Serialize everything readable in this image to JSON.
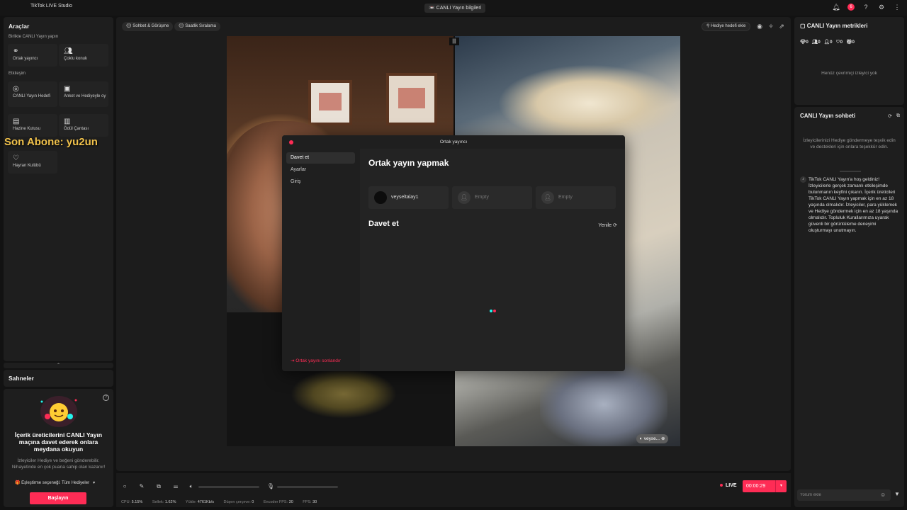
{
  "app": {
    "title": "TikTok LIVE Studio",
    "live_info_label": "📼 CANLI Yayın bilgileri",
    "notification_count": "6"
  },
  "tools": {
    "title": "Araçlar",
    "section_together": "Birlikte CANLI Yayın yapın",
    "cohost_label": "Ortak yayıncı",
    "multiguest_label": "Çoklu konuk",
    "section_interaction": "Etkileşim",
    "live_goal_label": "CANLI Yayın Hedefi",
    "poll_label": "Anket ve Hediyeyle oy",
    "treasure_label": "Hazine Kutusu",
    "reward_label": "Ödül Çantası",
    "fanclub_label": "Hayran Kulübü"
  },
  "overlay": {
    "last_sub": "Son Abone: yu2un"
  },
  "scenes": {
    "title": "Sahneler"
  },
  "promo": {
    "title": "İçerik üreticilerini CANLI Yayın maçına davet ederek onlara meydana okuyun",
    "desc": "İzleyiciler Hediye ve beğeni gönderebilir. Nihayetinde en çok puana sahip olan kazanır!",
    "match_select": "🎁 Eşleştirme seçeneği: Tüm Hediyeler",
    "start_label": "Başlayın"
  },
  "center": {
    "pill_chat": "Sohbet & Görüşme",
    "pill_ranking": "Saatlik Sıralama",
    "goal_label": "Hediye hedefi ekle",
    "guest_name": "veyse..."
  },
  "controls": {
    "live_label": "LIVE",
    "timer": "00:00:29",
    "stats": {
      "cpu_label": "CPU:",
      "cpu": "5.15%",
      "drop_label": "Sellek:",
      "drop": "1.62%",
      "upload_label": "Yükle:",
      "upload": "4761Kb/s",
      "dropped_label": "Düşen çerçeve:",
      "dropped": "0",
      "encoder_label": "Encoder FPS:",
      "encoder": "30",
      "fps_label": "FPS:",
      "fps": "30"
    }
  },
  "metrics": {
    "title": "CANLI Yayın metrikleri",
    "diamonds": "0",
    "viewers": "0",
    "new_followers": "0",
    "likes": "0",
    "gifts": "0",
    "no_viewers": "Henüz çevrimiçi izleyici yok"
  },
  "chat": {
    "title": "CANLI Yayın sohbeti",
    "gift_hint": "İzleyicilerinizi Hediye göndermeye teşvik edin ve destekleri için onlara teşekkür edin.",
    "welcome": "TikTok CANLI Yayın'a hoş geldiniz! İzleyicilerle gerçek zamanlı etkileşimde bulunmanın keyfini çıkarın. İçerik üreticileri TikTok CANLI Yayın yapmak için en az 18 yaşında olmalıdır. İzleyiciler, para yüklemek ve Hediye göndermek için en az 18 yaşında olmalıdır. Topluluk Kurallarımıza uyarak güvenli bir görüntüleme deneyimi oluşturmayı unutmayın.",
    "comment_placeholder": "Yorum ekle"
  },
  "modal": {
    "title": "Ortak yayıncı",
    "nav": [
      "Davet et",
      "Ayarlar",
      "Giriş"
    ],
    "end_label": "Ortak yayını sonlandır",
    "heading": "Ortak yayın yapmak",
    "slots": [
      {
        "name": "veyseltalay1"
      },
      {
        "name": "Empty"
      },
      {
        "name": "Empty"
      }
    ],
    "invite_heading": "Davet et",
    "refresh_label": "Yenile"
  },
  "colors": {
    "accent": "#fe2c55",
    "panel": "#1e1e1e",
    "background": "#121212"
  }
}
